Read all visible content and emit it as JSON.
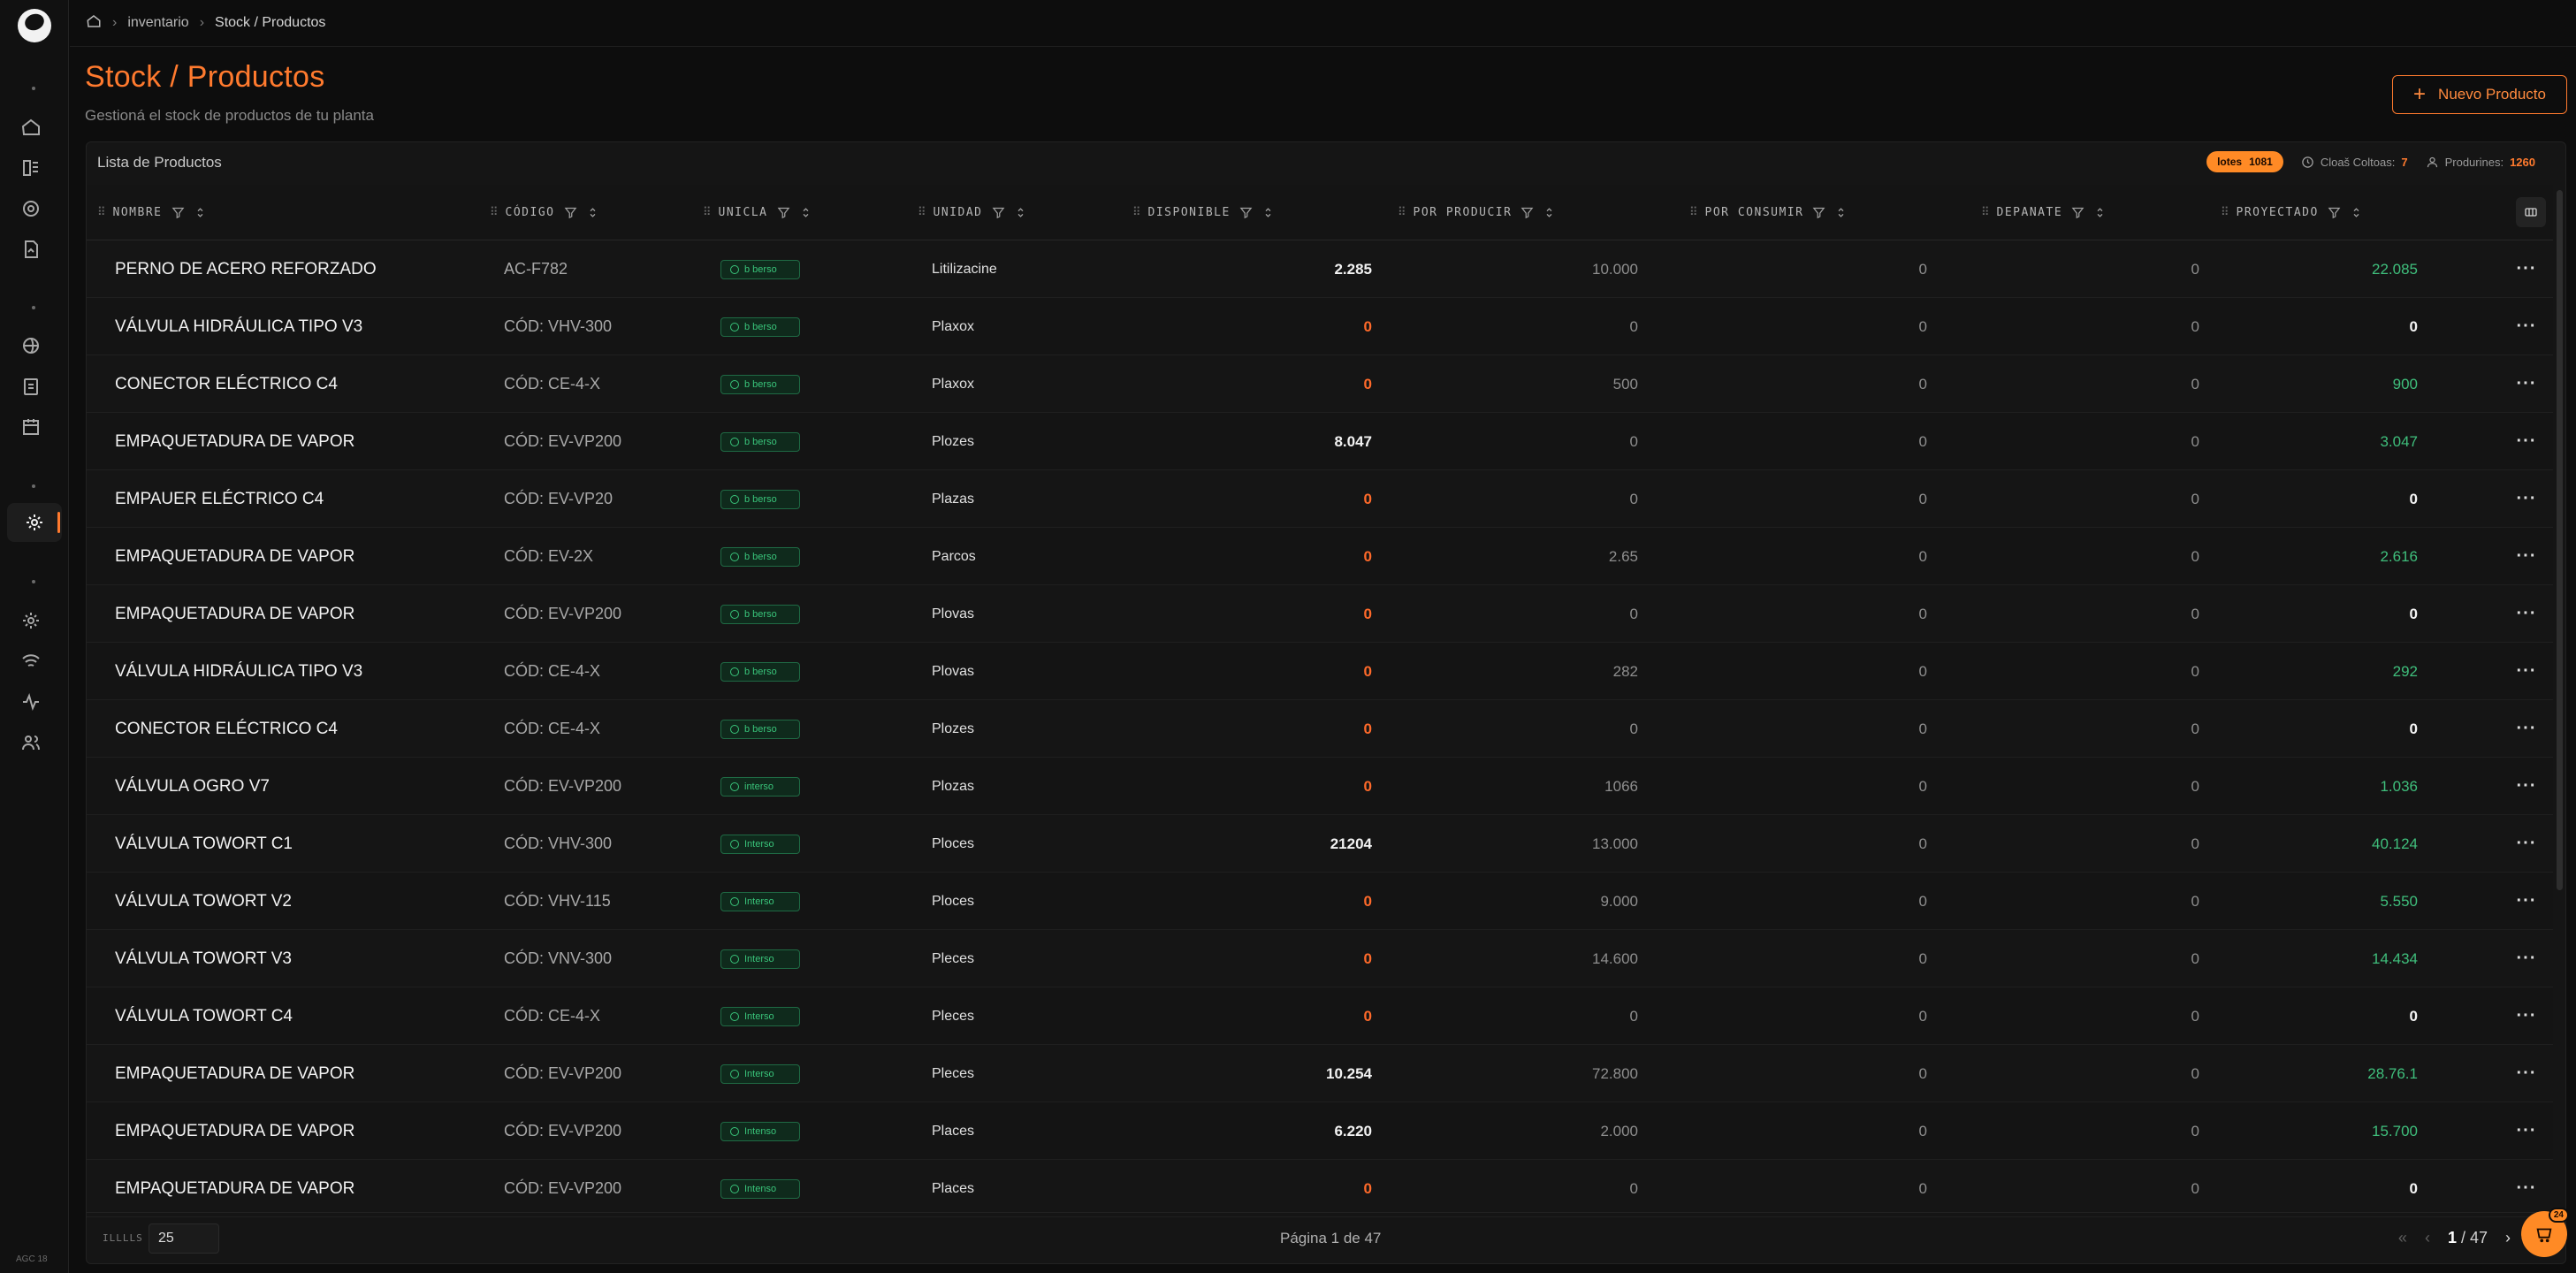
{
  "breadcrumb": {
    "section": "inventario",
    "current": "Stock / Productos"
  },
  "header": {
    "title": "Stock / Productos",
    "subtitle": "Gestioná el stock de productos de tu planta",
    "new_button": "Nuevo Producto"
  },
  "card": {
    "title": "Lista de Productos",
    "pill_label": "lotes",
    "pill_value": "1081",
    "meta_closed_label": "Cloaš Coltoas:",
    "meta_closed_value": "7",
    "meta_products_label": "Produrines:",
    "meta_products_value": "1260"
  },
  "columns": {
    "nombre": "NOMBRE",
    "codigo": "CÓDIGO",
    "unicla": "UNICLA",
    "unidad": "UNIDAD",
    "disponible": "DISPONIBLE",
    "por_producir": "POR PRODUCIR",
    "por_consumir": "POR CONSUMIR",
    "depanate": "DEPANATE",
    "proyectado": "PROYECTADO"
  },
  "rows": [
    {
      "name": "PERNO DE ACERO REFORZADO",
      "code": "AC-F782",
      "badge": "b berso",
      "unit": "Litilizacine",
      "disp": "2.285",
      "disp_zero": false,
      "prod": "10.000",
      "cons": "0",
      "dep": "0",
      "proj": "22.085",
      "proj_zero": false
    },
    {
      "name": "VÁLVULA HIDRÁULICA TIPO V3",
      "code": "CÓD: VHV-300",
      "badge": "b berso",
      "unit": "Plaxox",
      "disp": "0",
      "disp_zero": true,
      "prod": "0",
      "cons": "0",
      "dep": "0",
      "proj": "0",
      "proj_zero": true
    },
    {
      "name": "CONECTOR ELÉCTRICO C4",
      "code": "CÓD: CE-4-X",
      "badge": "b berso",
      "unit": "Plaxox",
      "disp": "0",
      "disp_zero": true,
      "prod": "500",
      "cons": "0",
      "dep": "0",
      "proj": "900",
      "proj_zero": false
    },
    {
      "name": "EMPAQUETADURA DE VAPOR",
      "code": "CÓD: EV-VP200",
      "badge": "b berso",
      "unit": "Plozes",
      "disp": "8.047",
      "disp_zero": false,
      "prod": "0",
      "cons": "0",
      "dep": "0",
      "proj": "3.047",
      "proj_zero": false
    },
    {
      "name": "EMPAUER ELÉCTRICO C4",
      "code": "CÓD: EV-VP20",
      "badge": "b berso",
      "unit": "Plazas",
      "disp": "0",
      "disp_zero": true,
      "prod": "0",
      "cons": "0",
      "dep": "0",
      "proj": "0",
      "proj_zero": true
    },
    {
      "name": "EMPAQUETADURA DE VAPOR",
      "code": "CÓD: EV-2X",
      "badge": "b berso",
      "unit": "Parcos",
      "disp": "0",
      "disp_zero": true,
      "prod": "2.65",
      "cons": "0",
      "dep": "0",
      "proj": "2.616",
      "proj_zero": false
    },
    {
      "name": "EMPAQUETADURA DE VAPOR",
      "code": "CÓD: EV-VP200",
      "badge": "b berso",
      "unit": "Plovas",
      "disp": "0",
      "disp_zero": true,
      "prod": "0",
      "cons": "0",
      "dep": "0",
      "proj": "0",
      "proj_zero": true
    },
    {
      "name": "VÁLVULA HIDRÁULICA TIPO V3",
      "code": "CÓD: CE-4-X",
      "badge": "b berso",
      "unit": "Plovas",
      "disp": "0",
      "disp_zero": true,
      "prod": "282",
      "cons": "0",
      "dep": "0",
      "proj": "292",
      "proj_zero": false
    },
    {
      "name": "CONECTOR ELÉCTRICO C4",
      "code": "CÓD: CE-4-X",
      "badge": "b berso",
      "unit": "Plozes",
      "disp": "0",
      "disp_zero": true,
      "prod": "0",
      "cons": "0",
      "dep": "0",
      "proj": "0",
      "proj_zero": true
    },
    {
      "name": "VÁLVULA OGRO V7",
      "code": "CÓD: EV-VP200",
      "badge": "interso",
      "unit": "Plozas",
      "disp": "0",
      "disp_zero": true,
      "prod": "1066",
      "cons": "0",
      "dep": "0",
      "proj": "1.036",
      "proj_zero": false
    },
    {
      "name": "VÁLVULA TOWORT C1",
      "code": "CÓD: VHV-300",
      "badge": "Interso",
      "unit": "Ploces",
      "disp": "21204",
      "disp_zero": false,
      "prod": "13.000",
      "cons": "0",
      "dep": "0",
      "proj": "40.124",
      "proj_zero": false
    },
    {
      "name": "VÁLVULA TOWORT V2",
      "code": "CÓD: VHV-115",
      "badge": "Interso",
      "unit": "Ploces",
      "disp": "0",
      "disp_zero": true,
      "prod": "9.000",
      "cons": "0",
      "dep": "0",
      "proj": "5.550",
      "proj_zero": false
    },
    {
      "name": "VÁLVULA TOWORT V3",
      "code": "CÓD: VNV-300",
      "badge": "Interso",
      "unit": "Pleces",
      "disp": "0",
      "disp_zero": true,
      "prod": "14.600",
      "cons": "0",
      "dep": "0",
      "proj": "14.434",
      "proj_zero": false
    },
    {
      "name": "VÁLVULA TOWORT C4",
      "code": "CÓD: CE-4-X",
      "badge": "Interso",
      "unit": "Pleces",
      "disp": "0",
      "disp_zero": true,
      "prod": "0",
      "cons": "0",
      "dep": "0",
      "proj": "0",
      "proj_zero": true
    },
    {
      "name": "EMPAQUETADURA DE VAPOR",
      "code": "CÓD: EV-VP200",
      "badge": "Interso",
      "unit": "Pleces",
      "disp": "10.254",
      "disp_zero": false,
      "prod": "72.800",
      "cons": "0",
      "dep": "0",
      "proj": "28.76.1",
      "proj_zero": false
    },
    {
      "name": "EMPAQUETADURA DE VAPOR",
      "code": "CÓD: EV-VP200",
      "badge": "Intenso",
      "unit": "Places",
      "disp": "6.220",
      "disp_zero": false,
      "prod": "2.000",
      "cons": "0",
      "dep": "0",
      "proj": "15.700",
      "proj_zero": false
    },
    {
      "name": "EMPAQUETADURA DE VAPOR",
      "code": "CÓD: EV-VP200",
      "badge": "Intenso",
      "unit": "Places",
      "disp": "0",
      "disp_zero": true,
      "prod": "0",
      "cons": "0",
      "dep": "0",
      "proj": "0",
      "proj_zero": true
    }
  ],
  "row_action_label": "···",
  "footer": {
    "rows_label": "ILLLLS",
    "page_size": "25",
    "page_text": "Página 1 de 47",
    "current_page": "1",
    "total_pages": "/ 47"
  },
  "fab_badge": "24",
  "sidebar_footer": "AGC 18",
  "colors": {
    "accent": "#ff7a2e",
    "positive": "#3fbf7c",
    "negative": "#ff6a2a"
  }
}
